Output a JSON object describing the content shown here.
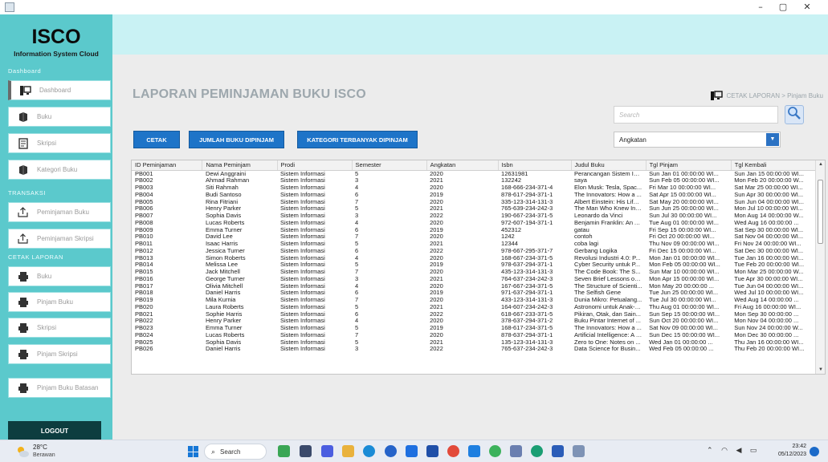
{
  "window": {
    "minimize": "–",
    "maximize": "▢",
    "close": "✕"
  },
  "app": {
    "brand": "ISCO",
    "brand_subtitle": "Information System Cloud"
  },
  "sidebar": {
    "section_dashboard": "Dashboard",
    "section_transaksi": "TRANSAKSI",
    "section_cetak": "CETAK LAPORAN",
    "items": [
      {
        "label": "Dashboard",
        "icon": "monitor-icon"
      },
      {
        "label": "Buku",
        "icon": "book-icon"
      },
      {
        "label": "Skripsi",
        "icon": "document-icon"
      },
      {
        "label": "Kategori Buku",
        "icon": "book-icon"
      },
      {
        "label": "Peminjaman Buku",
        "icon": "upload-icon"
      },
      {
        "label": "Peminjaman Skripsi",
        "icon": "upload-icon"
      },
      {
        "label": "Buku",
        "icon": "printer-icon"
      },
      {
        "label": "Pinjam Buku",
        "icon": "printer-icon"
      },
      {
        "label": "Skripsi",
        "icon": "printer-icon"
      },
      {
        "label": "Pinjam Skripsi",
        "icon": "printer-icon"
      },
      {
        "label": "Pinjam Buku Batasan",
        "icon": "printer-icon"
      }
    ],
    "logout": "LOGOUT"
  },
  "header": {
    "title": "LAPORAN PEMINJAMAN BUKU ISCO",
    "breadcrumb": "CETAK LAPORAN > Pinjam Buku"
  },
  "toolbar": {
    "search_placeholder": "Search",
    "btn_cetak": "CETAK",
    "btn_jumlah": "JUMLAH BUKU DIPINJAM",
    "btn_kategori": "KATEGORI TERBANYAK DIPINJAM",
    "filter_value": "Angkatan"
  },
  "table": {
    "columns": [
      "ID Peminjaman",
      "Nama Peminjam",
      "Prodi",
      "Semester",
      "Angkatan",
      "Isbn",
      "Judul Buku",
      "Tgl Pinjam",
      "Tgl Kembali"
    ],
    "rows": [
      [
        "PB001",
        "Dewi Anggraini",
        "Sistem Informasi",
        "5",
        "2020",
        "12631981",
        "Perancangan Sistem Inf...",
        "Sun Jan 01 00:00:00 WI...",
        "Sun Jan 15 00:00:00 WI..."
      ],
      [
        "PB002",
        "Ahmad Rahman",
        "Sistem Informasi",
        "3",
        "2021",
        "132242",
        "saya",
        "Sun Feb 05 00:00:00 WI...",
        "Mon Feb 20 00:00:00 W..."
      ],
      [
        "PB003",
        "Siti Rahmah",
        "Sistem Informasi",
        "4",
        "2020",
        "168-666-234-371-4",
        "Elon Musk: Tesla, Spac...",
        "Fri Mar 10 00:00:00 WI...",
        "Sat Mar 25 00:00:00 WI..."
      ],
      [
        "PB004",
        "Budi Santoso",
        "Sistem Informasi",
        "6",
        "2019",
        "878-617-294-371-1",
        "The Innovators: How a ...",
        "Sat Apr 15 00:00:00 WI...",
        "Sun Apr 30 00:00:00 WI..."
      ],
      [
        "PB005",
        "Rina Fitriani",
        "Sistem Informasi",
        "7",
        "2020",
        "335-123-314-131-3",
        "Albert Einstein: His Life ...",
        "Sat May 20 00:00:00 WI...",
        "Sun Jun 04 00:00:00 WI..."
      ],
      [
        "PB006",
        "Henry Parker",
        "Sistem Informasi",
        "5",
        "2021",
        "765-639-234-242-3",
        "The Man Who Knew Infi...",
        "Sun Jun 25 00:00:00 WI...",
        "Mon Jul 10 00:00:00 WI..."
      ],
      [
        "PB007",
        "Sophia Davis",
        "Sistem Informasi",
        "3",
        "2022",
        "190-667-234-371-5",
        "Leonardo da Vinci",
        "Sun Jul 30 00:00:00 WI...",
        "Mon Aug 14 00:00:00 W..."
      ],
      [
        "PB008",
        "Lucas Roberts",
        "Sistem Informasi",
        "4",
        "2020",
        "972-607-194-371-1",
        "Benjamin Franklin: An A...",
        "Tue Aug 01 00:00:00 WI...",
        "Wed Aug 16 00:00:00 ..."
      ],
      [
        "PB009",
        "Emma Turner",
        "Sistem Informasi",
        "6",
        "2019",
        "452312",
        "gatau",
        "Fri Sep 15 00:00:00 WI...",
        "Sat Sep 30 00:00:00 WI..."
      ],
      [
        "PB010",
        "David Lee",
        "Sistem Informasi",
        "7",
        "2020",
        "1242",
        "contoh",
        "Fri Oct 20 00:00:00 WI...",
        "Sat Nov 04 00:00:00 WI..."
      ],
      [
        "PB011",
        "Isaac Harris",
        "Sistem Informasi",
        "5",
        "2021",
        "12344",
        "coba lagi",
        "Thu Nov 09 00:00:00 WI...",
        "Fri Nov 24 00:00:00 WI..."
      ],
      [
        "PB012",
        "Jessica Turner",
        "Sistem Informasi",
        "6",
        "2022",
        "978-667-295-371-7",
        "Gerbang Logika",
        "Fri Dec 15 00:00:00 WI...",
        "Sat Dec 30 00:00:00 WI..."
      ],
      [
        "PB013",
        "Simon Roberts",
        "Sistem Informasi",
        "4",
        "2020",
        "168-667-234-371-5",
        "Revolusi Industri 4.0: P...",
        "Mon Jan 01 00:00:00 WI...",
        "Tue Jan 16 00:00:00 WI..."
      ],
      [
        "PB014",
        "Melissa Lee",
        "Sistem Informasi",
        "5",
        "2019",
        "978-637-294-371-1",
        "Cyber Security untuk P...",
        "Mon Feb 05 00:00:00 WI...",
        "Tue Feb 20 00:00:00 WI..."
      ],
      [
        "PB015",
        "Jack Mitchell",
        "Sistem Informasi",
        "7",
        "2020",
        "435-123-314-131-3",
        "The Code Book: The S...",
        "Sun Mar 10 00:00:00 WI...",
        "Mon Mar 25 00:00:00 W..."
      ],
      [
        "PB016",
        "George Turner",
        "Sistem Informasi",
        "3",
        "2021",
        "764-637-234-242-3",
        "Seven Brief Lessons on...",
        "Mon Apr 15 00:00:00 WI...",
        "Tue Apr 30 00:00:00 WI..."
      ],
      [
        "PB017",
        "Olivia Mitchell",
        "Sistem Informasi",
        "4",
        "2020",
        "167-667-234-371-5",
        "The Structure of Scienti...",
        "Mon May 20 00:00:00 ...",
        "Tue Jun 04 00:00:00 WI..."
      ],
      [
        "PB018",
        "Daniel Harris",
        "Sistem Informasi",
        "6",
        "2019",
        "971-637-294-371-1",
        "The Selfish Gene",
        "Tue Jun 25 00:00:00 WI...",
        "Wed Jul 10 00:00:00 WI..."
      ],
      [
        "PB019",
        "Mila Kurnia",
        "Sistem Informasi",
        "7",
        "2020",
        "433-123-314-131-3",
        "Dunia Mikro: Petualang...",
        "Tue Jul 30 00:00:00 WI...",
        "Wed Aug 14 00:00:00 ..."
      ],
      [
        "PB020",
        "Laura Roberts",
        "Sistem Informasi",
        "5",
        "2021",
        "164-607-234-242-3",
        "Astronomi untuk Anak-a...",
        "Thu Aug 01 00:00:00 WI...",
        "Fri Aug 16 00:00:00 WI..."
      ],
      [
        "PB021",
        "Sophie Harris",
        "Sistem Informasi",
        "6",
        "2022",
        "618-667-233-371-5",
        "Pikiran, Otak, dan Sain...",
        "Sun Sep 15 00:00:00 WI...",
        "Mon Sep 30 00:00:00 ..."
      ],
      [
        "PB022",
        "Henry Parker",
        "Sistem Informasi",
        "4",
        "2020",
        "378-637-294-371-2",
        "Buku Pintar Internet of ...",
        "Sun Oct 20 00:00:00 WI...",
        "Mon Nov 04 00:00:00 ..."
      ],
      [
        "PB023",
        "Emma Turner",
        "Sistem Informasi",
        "5",
        "2019",
        "168-617-234-371-5",
        "The Innovators: How a ...",
        "Sat Nov 09 00:00:00 WI...",
        "Sun Nov 24 00:00:00 W..."
      ],
      [
        "PB024",
        "Lucas Roberts",
        "Sistem Informasi",
        "7",
        "2020",
        "878-637-294-371-1",
        "Artificial Intelligence: A G...",
        "Sun Dec 15 00:00:00 WI...",
        "Mon Dec 30 00:00:00 ..."
      ],
      [
        "PB025",
        "Sophia Davis",
        "Sistem Informasi",
        "5",
        "2021",
        "135-123-314-131-3",
        "Zero to One: Notes on ...",
        "Wed Jan 01 00:00:00 ...",
        "Thu Jan 16 00:00:00 WI..."
      ],
      [
        "PB026",
        "Daniel Harris",
        "Sistem Informasi",
        "3",
        "2022",
        "765-637-234-242-3",
        "Data Science for Busin...",
        "Wed Feb 05 00:00:00 ...",
        "Thu Feb 20 00:00:00 WI..."
      ]
    ]
  },
  "taskbar": {
    "temperature": "28°C",
    "weather": "Berawan",
    "search": "Search",
    "time": "23:42",
    "date": "05/12/2023"
  },
  "colors": {
    "sidebar": "#5bc9cc",
    "top_band": "#c9f2f4",
    "primary_button": "#1e74c8",
    "logout": "#0d3d3f",
    "title_text": "#9da7ad"
  }
}
